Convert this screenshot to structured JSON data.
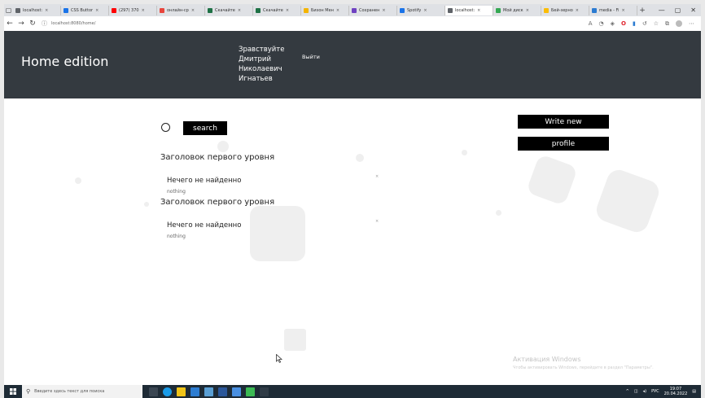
{
  "browser": {
    "tabs": [
      {
        "label": "localhost:",
        "favicon_color": "#5f6368"
      },
      {
        "label": "CSS Buttor",
        "favicon_color": "#1a73e8"
      },
      {
        "label": "(297) 370",
        "favicon_color": "#ff0000"
      },
      {
        "label": "онлайн-ср",
        "favicon_color": "#e8453c"
      },
      {
        "label": "Скачайте",
        "favicon_color": "#1e7145"
      },
      {
        "label": "Скачайте",
        "favicon_color": "#1e7145"
      },
      {
        "label": "Бизон Мен",
        "favicon_color": "#f4b400"
      },
      {
        "label": "Сохранен",
        "favicon_color": "#6f42c1"
      },
      {
        "label": "Spotify",
        "favicon_color": "#1a73e8"
      },
      {
        "label": "localhost:",
        "favicon_color": "#5f6368"
      },
      {
        "label": "Мой диск",
        "favicon_color": "#34a853"
      },
      {
        "label": "Бей-зерно",
        "favicon_color": "#fbbc05"
      },
      {
        "label": "media - Fi",
        "favicon_color": "#2b7bd1"
      }
    ],
    "active_tab_index": 9,
    "new_tab": "+",
    "window_controls": [
      "—",
      "▢",
      "✕"
    ],
    "url": "localhost:8080/home/"
  },
  "site": {
    "brand": "Home edition",
    "greeting_lines": [
      "Зравствуйте",
      "Дмитрий",
      "Николаевич",
      "Игнатьев"
    ],
    "logout": "Выйти"
  },
  "main": {
    "search_button": "search",
    "write_new_button": "Write new",
    "profile_button": "profile",
    "sections": [
      {
        "heading": "Заголовок первого уровня",
        "title": "Нечего не найденно",
        "subtitle": "nothing",
        "mark": "×"
      },
      {
        "heading": "Заголовок первого уровня",
        "title": "Нечего не найденно",
        "subtitle": "nothing",
        "mark": "×"
      }
    ]
  },
  "watermark": {
    "title": "Активация Windows",
    "subtitle": "Чтобы активировать Windows, перейдите в раздел \"Параметры\"."
  },
  "taskbar": {
    "search_placeholder": "Введите здесь текст для поиска",
    "language": "РУС",
    "time": "19:07",
    "date": "20.04.2022"
  },
  "colors": {
    "header_bg": "#343a40",
    "button_bg": "#000000",
    "taskbar_bg": "#1e2b36"
  }
}
